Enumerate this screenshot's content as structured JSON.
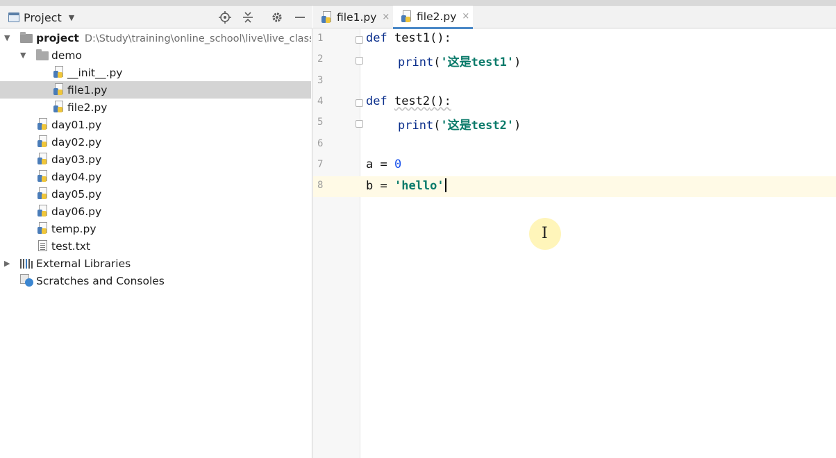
{
  "project_panel": {
    "title": "Project",
    "tree": [
      {
        "label": "project",
        "path": "D:\\Study\\training\\online_school\\live\\live_class\\"
      },
      {
        "label": "demo"
      },
      {
        "label": "__init__.py"
      },
      {
        "label": "file1.py"
      },
      {
        "label": "file2.py"
      },
      {
        "label": "day01.py"
      },
      {
        "label": "day02.py"
      },
      {
        "label": "day03.py"
      },
      {
        "label": "day04.py"
      },
      {
        "label": "day05.py"
      },
      {
        "label": "day06.py"
      },
      {
        "label": "temp.py"
      },
      {
        "label": "test.txt"
      },
      {
        "label": "External Libraries"
      },
      {
        "label": "Scratches and Consoles"
      }
    ]
  },
  "editor": {
    "tabs": [
      {
        "label": "file1.py",
        "close": "×"
      },
      {
        "label": "file2.py",
        "close": "×"
      }
    ],
    "line_numbers": [
      "1",
      "2",
      "3",
      "4",
      "5",
      "6",
      "7",
      "8"
    ],
    "code": {
      "l1_kw": "def",
      "l1_name": "test1",
      "l1_rest": "():",
      "l2_fn": "print",
      "l2_open": "(",
      "l2_str": "'这是test1'",
      "l2_close": ")",
      "l4_kw": "def",
      "l4_name": "test2",
      "l4_rest": "():",
      "l5_fn": "print",
      "l5_open": "(",
      "l5_str": "'这是test2'",
      "l5_close": ")",
      "l7_var": "a",
      "l7_eq": " = ",
      "l7_num": "0",
      "l8_var": "b",
      "l8_eq": " = ",
      "l8_str": "'hello'"
    }
  },
  "icons": {
    "locate": "crosshair-icon",
    "collapse": "collapse-all-icon",
    "settings": "gear-icon",
    "hide": "minimize-icon"
  },
  "colors": {
    "keyword": "#0b2f8c",
    "string": "#0a7a6a",
    "number": "#1750eb",
    "selection": "#d4d4d4",
    "current_line": "#fffae6",
    "tab_underline": "#4a88c7"
  }
}
